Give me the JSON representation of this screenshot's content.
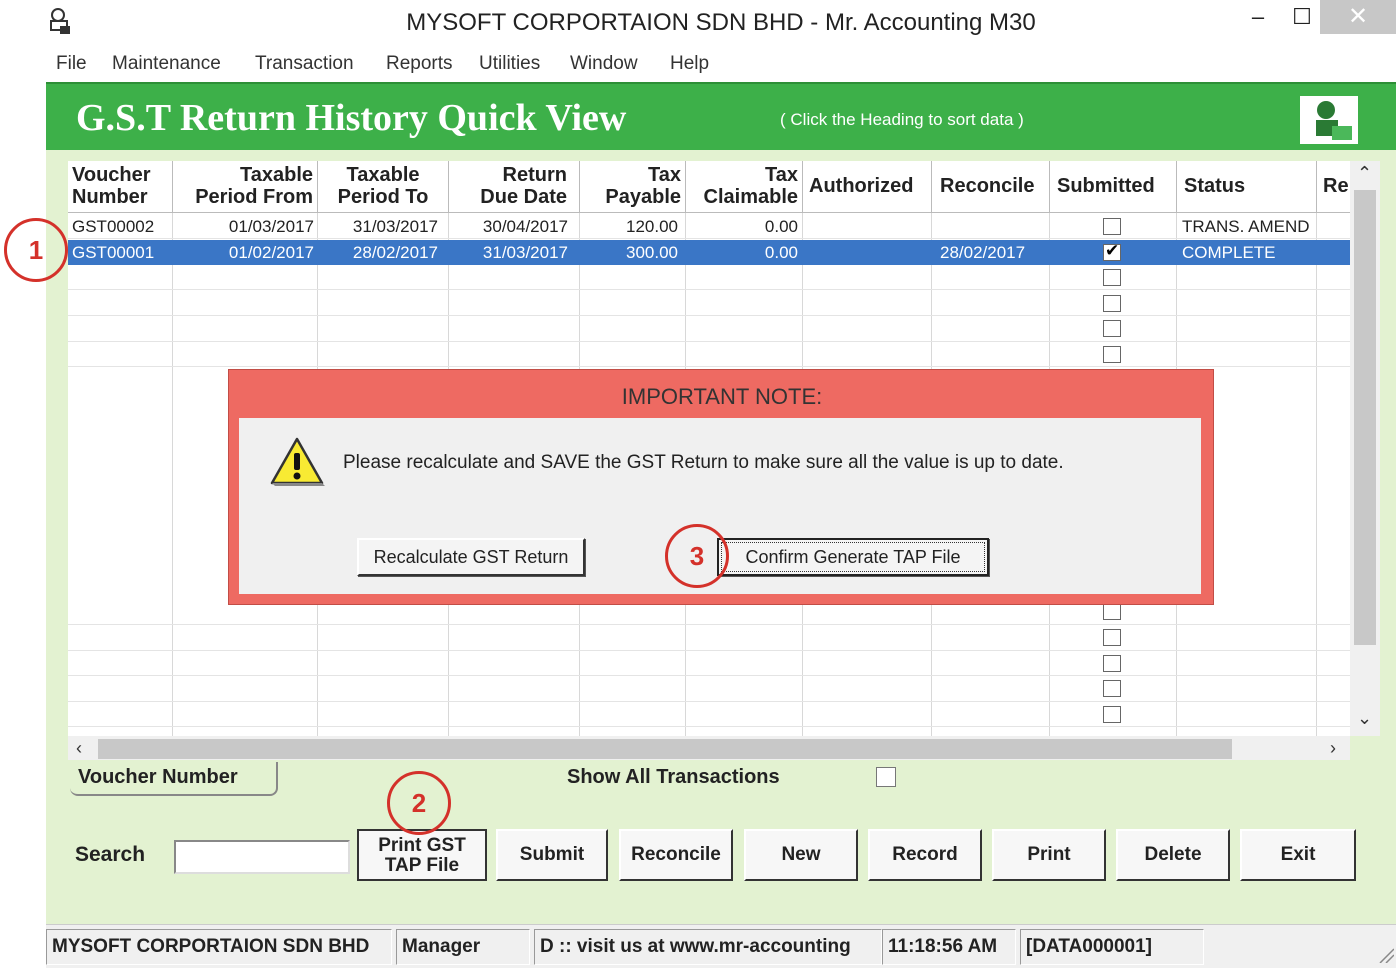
{
  "window": {
    "title": "MYSOFT CORPORTAION SDN BHD - Mr. Accounting M30",
    "minimize": "–",
    "maximize": "☐",
    "close": "✕"
  },
  "menu": [
    "File",
    "Maintenance",
    "Transaction",
    "Reports",
    "Utilities",
    "Window",
    "Help"
  ],
  "header": {
    "title": "G.S.T Return History Quick View",
    "hint": "( Click the Heading to sort data )"
  },
  "grid": {
    "columns": [
      {
        "line1": "Voucher",
        "line2": "Number"
      },
      {
        "line1": "Taxable",
        "line2": "Period From"
      },
      {
        "line1": "Taxable",
        "line2": "Period To"
      },
      {
        "line1": "Return",
        "line2": "Due Date"
      },
      {
        "line1": "Tax",
        "line2": "Payable"
      },
      {
        "line1": "Tax",
        "line2": "Claimable"
      },
      {
        "line1": "Authorized",
        "line2": ""
      },
      {
        "line1": "Reconcile",
        "line2": ""
      },
      {
        "line1": "Submitted",
        "line2": ""
      },
      {
        "line1": "Status",
        "line2": ""
      },
      {
        "line1": "Re",
        "line2": ""
      }
    ],
    "rows": [
      {
        "voucher": "GST00002",
        "from": "01/03/2017",
        "to": "31/03/2017",
        "due": "30/04/2017",
        "payable": "120.00",
        "claimable": "0.00",
        "authorized": "",
        "reconcile": "",
        "submitted": false,
        "status": "TRANS. AMEND"
      },
      {
        "voucher": "GST00001",
        "from": "01/02/2017",
        "to": "28/02/2017",
        "due": "31/03/2017",
        "payable": "300.00",
        "claimable": "0.00",
        "authorized": "",
        "reconcile": "28/02/2017",
        "submitted": true,
        "status": "COMPLETE"
      }
    ]
  },
  "dialog": {
    "title": "IMPORTANT NOTE:",
    "message": "Please recalculate and SAVE the GST Return to make sure all the value is up to date.",
    "recalc_button": "Recalculate GST Return",
    "confirm_button": "Confirm Generate TAP File"
  },
  "bottom": {
    "voucher_tab": "Voucher Number",
    "show_all": "Show All Transactions",
    "search_label": "Search",
    "search_value": "",
    "buttons": {
      "print_tap_1": "Print GST",
      "print_tap_2": "TAP File",
      "submit": "Submit",
      "reconcile": "Reconcile",
      "new": "New",
      "record": "Record",
      "print": "Print",
      "delete": "Delete",
      "exit": "Exit"
    }
  },
  "status": {
    "company": "MYSOFT CORPORTAION SDN BHD",
    "user": "Manager",
    "info": "D  :: visit us at www.mr-accounting",
    "time": "11:18:56 AM",
    "data": "[DATA000001]"
  },
  "callouts": [
    "1",
    "2",
    "3"
  ],
  "colors": {
    "header_green": "#3db049",
    "frame_green": "#e3f2d1",
    "selected_row": "#3a76c6",
    "dialog_red": "#ee6a62",
    "callout_red": "#d4312a"
  }
}
